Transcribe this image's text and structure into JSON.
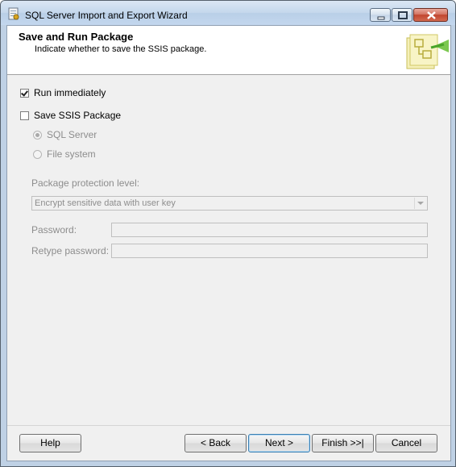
{
  "window": {
    "title": "SQL Server Import and Export Wizard"
  },
  "header": {
    "title": "Save and Run Package",
    "subtitle": "Indicate whether to save the SSIS package."
  },
  "options": {
    "run_immediately": {
      "label": "Run immediately",
      "checked": true
    },
    "save_ssis_package": {
      "label": "Save SSIS Package",
      "checked": false
    },
    "sql_server": {
      "label": "SQL Server",
      "selected": true,
      "enabled": false
    },
    "file_system": {
      "label": "File system",
      "selected": false,
      "enabled": false
    }
  },
  "protection": {
    "label": "Package protection level:",
    "value": "Encrypt sensitive data with user key"
  },
  "password": {
    "label": "Password:",
    "value": ""
  },
  "retype_password": {
    "label": "Retype password:",
    "value": ""
  },
  "buttons": {
    "help": "Help",
    "back": "< Back",
    "next": "Next >",
    "finish": "Finish >>|",
    "cancel": "Cancel"
  }
}
